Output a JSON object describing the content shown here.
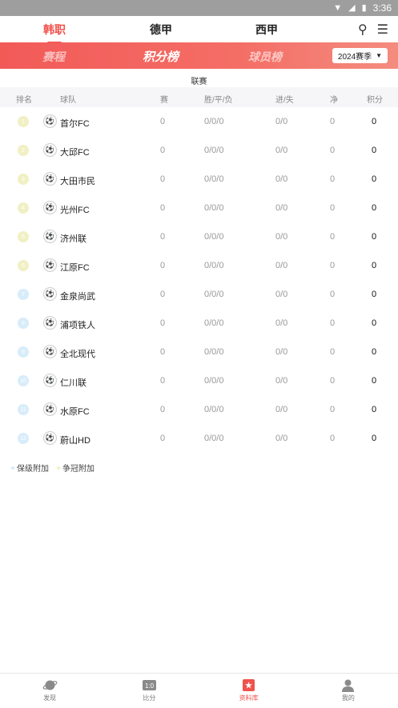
{
  "status_bar": {
    "time": "3:36"
  },
  "top_tabs": [
    {
      "label": "韩职",
      "active": true
    },
    {
      "label": "德甲",
      "active": false
    },
    {
      "label": "西甲",
      "active": false
    }
  ],
  "sub_tabs": [
    {
      "label": "赛程",
      "active": false
    },
    {
      "label": "积分榜",
      "active": true
    },
    {
      "label": "球员榜",
      "active": false
    }
  ],
  "season_select": {
    "value": "2024赛季"
  },
  "league_label": "联赛",
  "table": {
    "headers": {
      "rank": "排名",
      "team": "球队",
      "played": "赛",
      "wdl": "胜/平/负",
      "gfga": "进/失",
      "gd": "净",
      "pts": "积分"
    },
    "rows": [
      {
        "rank": "1",
        "team": "首尔FC",
        "played": "0",
        "wdl": "0/0/0",
        "gfga": "0/0",
        "gd": "0",
        "pts": "0",
        "zone": "yellow"
      },
      {
        "rank": "2",
        "team": "大邱FC",
        "played": "0",
        "wdl": "0/0/0",
        "gfga": "0/0",
        "gd": "0",
        "pts": "0",
        "zone": "yellow"
      },
      {
        "rank": "3",
        "team": "大田市民",
        "played": "0",
        "wdl": "0/0/0",
        "gfga": "0/0",
        "gd": "0",
        "pts": "0",
        "zone": "yellow"
      },
      {
        "rank": "4",
        "team": "光州FC",
        "played": "0",
        "wdl": "0/0/0",
        "gfga": "0/0",
        "gd": "0",
        "pts": "0",
        "zone": "yellow"
      },
      {
        "rank": "5",
        "team": "济州联",
        "played": "0",
        "wdl": "0/0/0",
        "gfga": "0/0",
        "gd": "0",
        "pts": "0",
        "zone": "yellow"
      },
      {
        "rank": "6",
        "team": "江原FC",
        "played": "0",
        "wdl": "0/0/0",
        "gfga": "0/0",
        "gd": "0",
        "pts": "0",
        "zone": "yellow"
      },
      {
        "rank": "7",
        "team": "金泉尚武",
        "played": "0",
        "wdl": "0/0/0",
        "gfga": "0/0",
        "gd": "0",
        "pts": "0",
        "zone": "blue"
      },
      {
        "rank": "8",
        "team": "浦项铁人",
        "played": "0",
        "wdl": "0/0/0",
        "gfga": "0/0",
        "gd": "0",
        "pts": "0",
        "zone": "blue"
      },
      {
        "rank": "9",
        "team": "全北现代",
        "played": "0",
        "wdl": "0/0/0",
        "gfga": "0/0",
        "gd": "0",
        "pts": "0",
        "zone": "blue"
      },
      {
        "rank": "10",
        "team": "仁川联",
        "played": "0",
        "wdl": "0/0/0",
        "gfga": "0/0",
        "gd": "0",
        "pts": "0",
        "zone": "blue"
      },
      {
        "rank": "11",
        "team": "水原FC",
        "played": "0",
        "wdl": "0/0/0",
        "gfga": "0/0",
        "gd": "0",
        "pts": "0",
        "zone": "blue"
      },
      {
        "rank": "12",
        "team": "蔚山HD",
        "played": "0",
        "wdl": "0/0/0",
        "gfga": "0/0",
        "gd": "0",
        "pts": "0",
        "zone": "blue"
      }
    ]
  },
  "legend": [
    {
      "label": "保级附加",
      "color": "#d8ecfa"
    },
    {
      "label": "争冠附加",
      "color": "#f1f0c4"
    }
  ],
  "bottom_nav": [
    {
      "label": "发现",
      "icon": "planet-icon",
      "active": false
    },
    {
      "label": "比分",
      "icon": "scoreboard-icon",
      "active": false
    },
    {
      "label": "资料库",
      "icon": "database-icon",
      "active": true
    },
    {
      "label": "我的",
      "icon": "user-icon",
      "active": false
    }
  ],
  "colors": {
    "accent": "#f0514c",
    "header_gradient_start": "#f25a58",
    "header_gradient_end": "#f48c7e"
  }
}
